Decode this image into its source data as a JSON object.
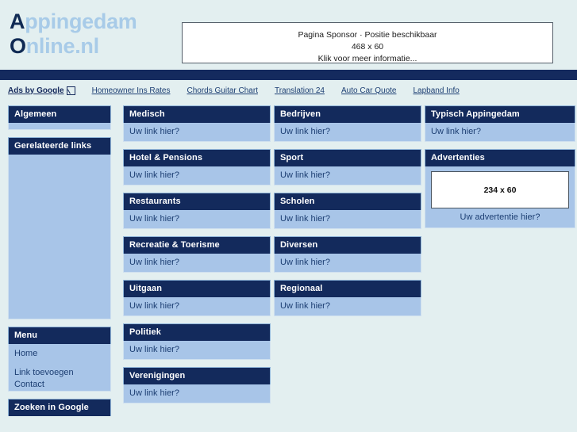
{
  "site": {
    "logo_line1_cap": "A",
    "logo_line1_rest": "ppingedam",
    "logo_line2_cap": "O",
    "logo_line2_rest": "nline.nl"
  },
  "sponsor": {
    "line1": "Pagina Sponsor · Positie beschikbaar",
    "line2": "468 x 60",
    "line3": "Klik voor meer informatie..."
  },
  "ads_strip": {
    "provider_label": "Ads by Google",
    "links": [
      "Homeowner Ins Rates",
      "Chords Guitar Chart",
      "Translation 24",
      "Auto Car Quote",
      "Lapband Info"
    ]
  },
  "sidebar": {
    "algemeen": {
      "title": "Algemeen"
    },
    "gerelateerde": {
      "title": "Gerelateerde links"
    },
    "menu": {
      "title": "Menu",
      "items": [
        "Home",
        "Link toevoegen",
        "Contact"
      ]
    },
    "zoeken": {
      "title": "Zoeken in Google"
    }
  },
  "columns": {
    "one": [
      {
        "title": "Medisch",
        "link": "Uw link hier?"
      },
      {
        "title": "Hotel & Pensions",
        "link": "Uw link hier?"
      },
      {
        "title": "Restaurants",
        "link": "Uw link hier?"
      },
      {
        "title": "Recreatie & Toerisme",
        "link": "Uw link hier?"
      },
      {
        "title": "Uitgaan",
        "link": "Uw link hier?"
      },
      {
        "title": "Politiek",
        "link": "Uw link hier?"
      },
      {
        "title": "Verenigingen",
        "link": "Uw link hier?"
      }
    ],
    "two": [
      {
        "title": "Bedrijven",
        "link": "Uw link hier?"
      },
      {
        "title": "Sport",
        "link": "Uw link hier?"
      },
      {
        "title": "Scholen",
        "link": "Uw link hier?"
      },
      {
        "title": "Diversen",
        "link": "Uw link hier?"
      },
      {
        "title": "Regionaal",
        "link": "Uw link hier?"
      }
    ],
    "three": {
      "typisch": {
        "title": "Typisch Appingedam",
        "link": "Uw link hier?"
      },
      "advertenties": {
        "title": "Advertenties",
        "ad_size": "234 x 60",
        "caption": "Uw advertentie hier?"
      }
    }
  },
  "colors": {
    "background": "#e3eff0",
    "navy": "#132a5c",
    "panel_body": "#a8c5e8",
    "logo_light": "#a8cbe8",
    "logo_dark": "#102a54"
  }
}
